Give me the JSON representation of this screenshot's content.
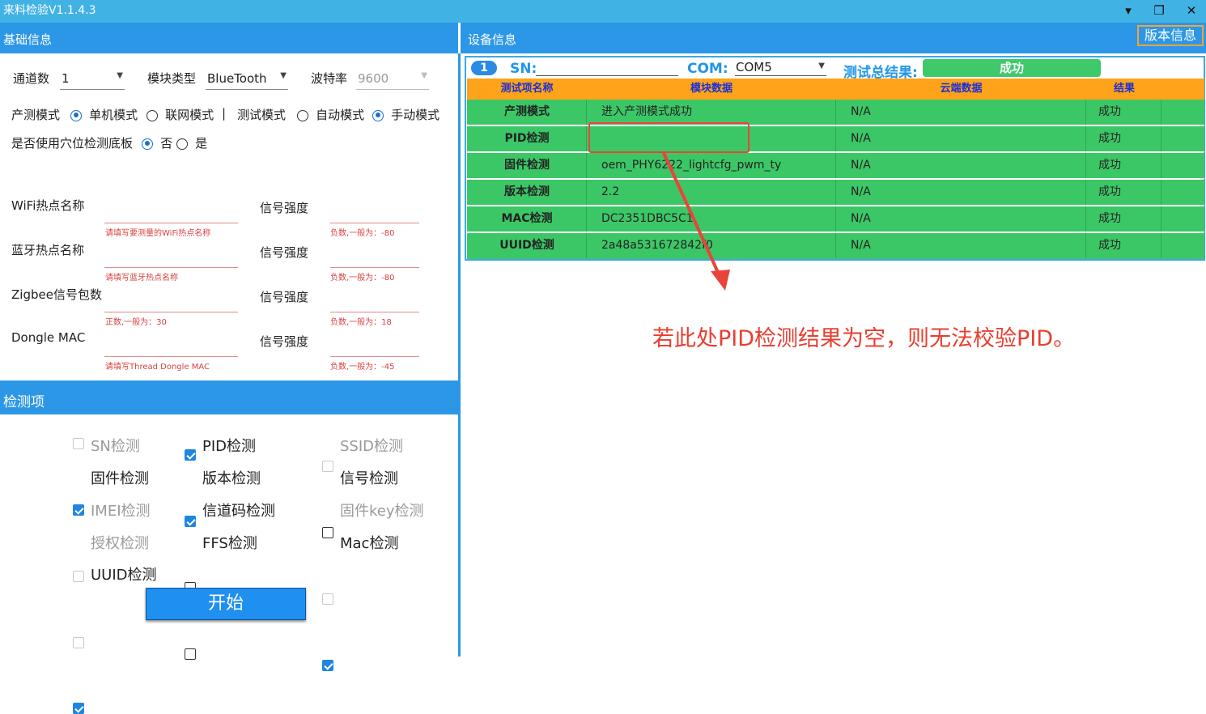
{
  "window": {
    "title": "来料检验V1.1.4.3",
    "min": "▾",
    "restore": "❐",
    "close": "✕"
  },
  "left": {
    "header": "基础信息",
    "channels_label": "通道数",
    "channels_value": "1",
    "module_type_label": "模块类型",
    "module_type_value": "BlueTooth",
    "baud_label": "波特率",
    "baud_value": "9600",
    "prod_mode_label": "产测模式",
    "prod_modes": [
      "单机模式",
      "联网模式"
    ],
    "sep": "|",
    "test_mode_label": "测试模式",
    "test_modes": [
      "自动模式",
      "手动模式"
    ],
    "hole_label": "是否使用穴位检测底板",
    "hole_options": [
      "否",
      "是"
    ],
    "signals": [
      {
        "label": "WiFi热点名称",
        "hint": "请填写要测量的WiFi热点名称",
        "strength_label": "信号强度",
        "strength_hint": "负数,一般为：-80"
      },
      {
        "label": "蓝牙热点名称",
        "hint": "请填写蓝牙热点名称",
        "strength_label": "信号强度",
        "strength_hint": "负数,一般为：-80"
      },
      {
        "label": "Zigbee信号包数",
        "hint": "正数,一般为：30",
        "strength_label": "信号强度",
        "strength_hint": "负数,一般为：18"
      },
      {
        "label": "Dongle MAC",
        "hint": "请填写Thread Dongle MAC",
        "strength_label": "信号强度",
        "strength_hint": "负数,一般为：-45"
      }
    ],
    "checks_header": "检测项",
    "checks": [
      {
        "label": "SN检测",
        "checked": false,
        "disabled": true
      },
      {
        "label": "PID检测",
        "checked": true,
        "disabled": false
      },
      {
        "label": "SSID检测",
        "checked": false,
        "disabled": true
      },
      {
        "label": "固件检测",
        "checked": true,
        "disabled": false
      },
      {
        "label": "版本检测",
        "checked": true,
        "disabled": false
      },
      {
        "label": "信号检测",
        "checked": false,
        "disabled": false
      },
      {
        "label": "IMEI检测",
        "checked": false,
        "disabled": true
      },
      {
        "label": "信道码检测",
        "checked": false,
        "disabled": false
      },
      {
        "label": "固件key检测",
        "checked": false,
        "disabled": true
      },
      {
        "label": "授权检测",
        "checked": false,
        "disabled": true
      },
      {
        "label": "FFS检测",
        "checked": false,
        "disabled": false
      },
      {
        "label": "Mac检测",
        "checked": true,
        "disabled": false
      },
      {
        "label": "UUID检测",
        "checked": true,
        "disabled": false
      }
    ],
    "start_button": "开始"
  },
  "right": {
    "header": "设备信息",
    "version_button": "版本信息",
    "channel_badge": "1",
    "sn_label": "SN:",
    "com_label": "COM:",
    "com_value": "COM5",
    "total_label": "测试总结果:",
    "total_value": "成功",
    "columns": [
      "测试项名称",
      "模块数据",
      "云端数据",
      "结果"
    ],
    "rows": [
      {
        "name": "产测模式",
        "module": "进入产测模式成功",
        "cloud": "N/A",
        "result": "成功"
      },
      {
        "name": "PID检测",
        "module": "",
        "cloud": "N/A",
        "result": "成功"
      },
      {
        "name": "固件检测",
        "module": "oem_PHY6222_lightcfg_pwm_ty",
        "cloud": "N/A",
        "result": "成功"
      },
      {
        "name": "版本检测",
        "module": "2.2",
        "cloud": "N/A",
        "result": "成功"
      },
      {
        "name": "MAC检测",
        "module": "DC2351DBC5C1",
        "cloud": "N/A",
        "result": "成功"
      },
      {
        "name": "UUID检测",
        "module": "2a48a531672842f0",
        "cloud": "N/A",
        "result": "成功"
      }
    ],
    "annotation": "若此处PID检测结果为空，则无法校验PID。"
  },
  "colors": {
    "accent": "#2d97e7",
    "titlebar": "#41b2e4",
    "success": "#3cc767",
    "table_header": "#ffa31a",
    "annotation": "#e83e2f"
  }
}
